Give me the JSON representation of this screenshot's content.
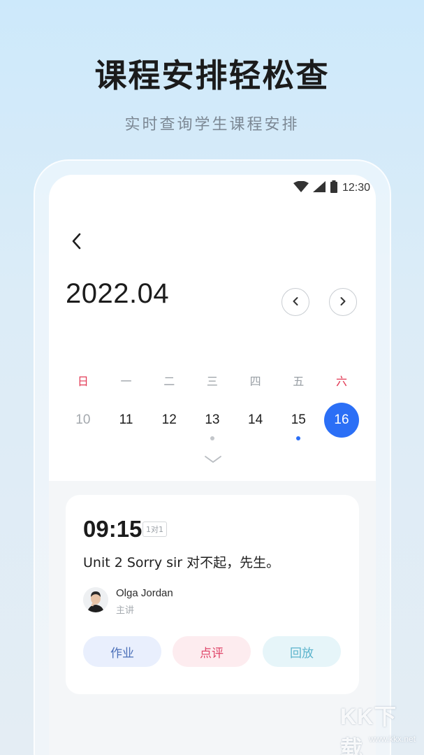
{
  "promo": {
    "headline": "课程安排轻松查",
    "subline": "实时查询学生课程安排"
  },
  "status_bar": {
    "time": "12:30",
    "icons": [
      "wifi-icon",
      "signal-icon",
      "battery-icon"
    ]
  },
  "calendar": {
    "month_title": "2022.04",
    "weekdays": [
      "日",
      "一",
      "二",
      "三",
      "四",
      "五",
      "六"
    ],
    "dates": [
      {
        "label": "10",
        "state": "past"
      },
      {
        "label": "11",
        "state": "normal"
      },
      {
        "label": "12",
        "state": "normal"
      },
      {
        "label": "13",
        "state": "normal",
        "dot": "grey"
      },
      {
        "label": "14",
        "state": "normal"
      },
      {
        "label": "15",
        "state": "normal",
        "dot": "blue"
      },
      {
        "label": "16",
        "state": "selected"
      }
    ]
  },
  "lesson": {
    "time": "09:15",
    "tag": "1对1",
    "course": "Unit 2 Sorry sir 对不起，先生。",
    "teacher_name": "Olga Jordan",
    "teacher_role": "主讲",
    "actions": {
      "homework": "作业",
      "review": "点评",
      "replay": "回放"
    }
  },
  "watermark": {
    "big": "KK下载",
    "small": "www.kkx.net"
  },
  "colors": {
    "accent": "#2b6ff6",
    "weekend_red": "#e23a55"
  }
}
